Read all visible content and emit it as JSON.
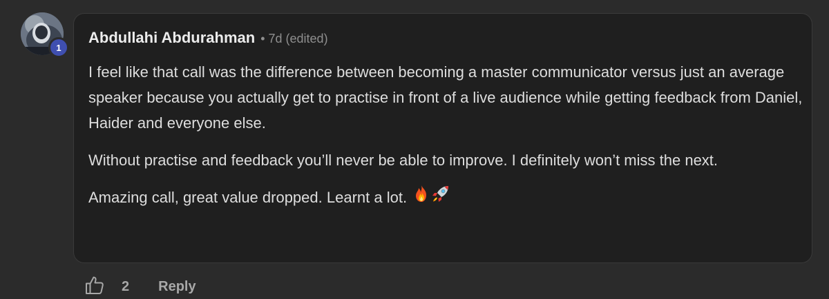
{
  "comment": {
    "author": "Abdullahi Abdurahman",
    "separator": "•",
    "time": "7d",
    "edited_label": "(edited)",
    "level": "1",
    "paragraphs": [
      "I feel like that call was the difference between becoming a master communicator versus just an average speaker because you actually get to practise in front of a live audience while getting feedback from Daniel, Haider and everyone else.",
      "Without practise and feedback you’ll never be able to improve. I definitely won’t miss the next.",
      "Amazing call, great value dropped. Learnt a lot."
    ],
    "emojis": [
      "fire-icon",
      "rocket-icon"
    ]
  },
  "actions": {
    "like_icon": "thumbs-up-icon",
    "like_count": "2",
    "reply_label": "Reply"
  },
  "colors": {
    "page_bg": "#2b2b2b",
    "card_bg": "#1f1f1f",
    "card_border": "#3a3a3a",
    "text_primary": "#ececec",
    "text_body": "#dedede",
    "text_muted": "#8f8f8f",
    "badge": "#3f4fb0"
  }
}
